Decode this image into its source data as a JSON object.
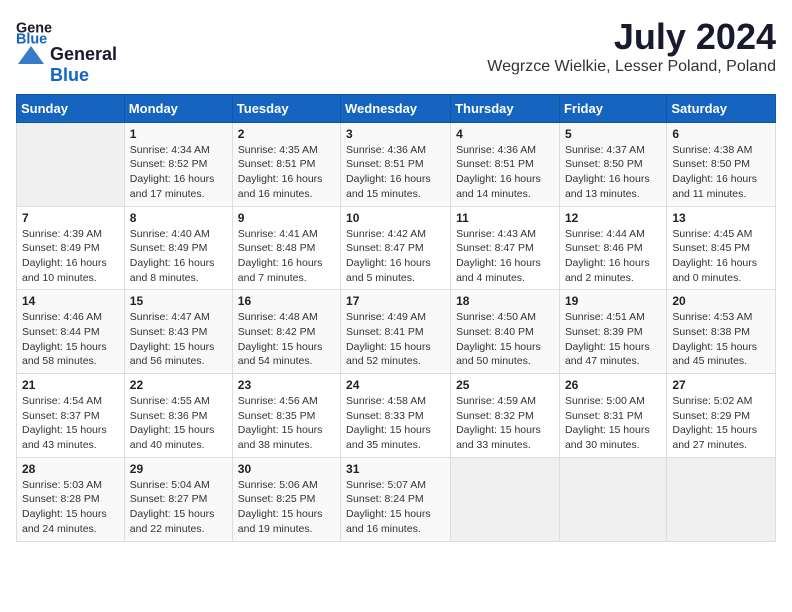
{
  "header": {
    "logo_general": "General",
    "logo_blue": "Blue",
    "month": "July 2024",
    "location": "Wegrzce Wielkie, Lesser Poland, Poland"
  },
  "days_of_week": [
    "Sunday",
    "Monday",
    "Tuesday",
    "Wednesday",
    "Thursday",
    "Friday",
    "Saturday"
  ],
  "weeks": [
    [
      {
        "num": "",
        "info": ""
      },
      {
        "num": "1",
        "info": "Sunrise: 4:34 AM\nSunset: 8:52 PM\nDaylight: 16 hours\nand 17 minutes."
      },
      {
        "num": "2",
        "info": "Sunrise: 4:35 AM\nSunset: 8:51 PM\nDaylight: 16 hours\nand 16 minutes."
      },
      {
        "num": "3",
        "info": "Sunrise: 4:36 AM\nSunset: 8:51 PM\nDaylight: 16 hours\nand 15 minutes."
      },
      {
        "num": "4",
        "info": "Sunrise: 4:36 AM\nSunset: 8:51 PM\nDaylight: 16 hours\nand 14 minutes."
      },
      {
        "num": "5",
        "info": "Sunrise: 4:37 AM\nSunset: 8:50 PM\nDaylight: 16 hours\nand 13 minutes."
      },
      {
        "num": "6",
        "info": "Sunrise: 4:38 AM\nSunset: 8:50 PM\nDaylight: 16 hours\nand 11 minutes."
      }
    ],
    [
      {
        "num": "7",
        "info": "Sunrise: 4:39 AM\nSunset: 8:49 PM\nDaylight: 16 hours\nand 10 minutes."
      },
      {
        "num": "8",
        "info": "Sunrise: 4:40 AM\nSunset: 8:49 PM\nDaylight: 16 hours\nand 8 minutes."
      },
      {
        "num": "9",
        "info": "Sunrise: 4:41 AM\nSunset: 8:48 PM\nDaylight: 16 hours\nand 7 minutes."
      },
      {
        "num": "10",
        "info": "Sunrise: 4:42 AM\nSunset: 8:47 PM\nDaylight: 16 hours\nand 5 minutes."
      },
      {
        "num": "11",
        "info": "Sunrise: 4:43 AM\nSunset: 8:47 PM\nDaylight: 16 hours\nand 4 minutes."
      },
      {
        "num": "12",
        "info": "Sunrise: 4:44 AM\nSunset: 8:46 PM\nDaylight: 16 hours\nand 2 minutes."
      },
      {
        "num": "13",
        "info": "Sunrise: 4:45 AM\nSunset: 8:45 PM\nDaylight: 16 hours\nand 0 minutes."
      }
    ],
    [
      {
        "num": "14",
        "info": "Sunrise: 4:46 AM\nSunset: 8:44 PM\nDaylight: 15 hours\nand 58 minutes."
      },
      {
        "num": "15",
        "info": "Sunrise: 4:47 AM\nSunset: 8:43 PM\nDaylight: 15 hours\nand 56 minutes."
      },
      {
        "num": "16",
        "info": "Sunrise: 4:48 AM\nSunset: 8:42 PM\nDaylight: 15 hours\nand 54 minutes."
      },
      {
        "num": "17",
        "info": "Sunrise: 4:49 AM\nSunset: 8:41 PM\nDaylight: 15 hours\nand 52 minutes."
      },
      {
        "num": "18",
        "info": "Sunrise: 4:50 AM\nSunset: 8:40 PM\nDaylight: 15 hours\nand 50 minutes."
      },
      {
        "num": "19",
        "info": "Sunrise: 4:51 AM\nSunset: 8:39 PM\nDaylight: 15 hours\nand 47 minutes."
      },
      {
        "num": "20",
        "info": "Sunrise: 4:53 AM\nSunset: 8:38 PM\nDaylight: 15 hours\nand 45 minutes."
      }
    ],
    [
      {
        "num": "21",
        "info": "Sunrise: 4:54 AM\nSunset: 8:37 PM\nDaylight: 15 hours\nand 43 minutes."
      },
      {
        "num": "22",
        "info": "Sunrise: 4:55 AM\nSunset: 8:36 PM\nDaylight: 15 hours\nand 40 minutes."
      },
      {
        "num": "23",
        "info": "Sunrise: 4:56 AM\nSunset: 8:35 PM\nDaylight: 15 hours\nand 38 minutes."
      },
      {
        "num": "24",
        "info": "Sunrise: 4:58 AM\nSunset: 8:33 PM\nDaylight: 15 hours\nand 35 minutes."
      },
      {
        "num": "25",
        "info": "Sunrise: 4:59 AM\nSunset: 8:32 PM\nDaylight: 15 hours\nand 33 minutes."
      },
      {
        "num": "26",
        "info": "Sunrise: 5:00 AM\nSunset: 8:31 PM\nDaylight: 15 hours\nand 30 minutes."
      },
      {
        "num": "27",
        "info": "Sunrise: 5:02 AM\nSunset: 8:29 PM\nDaylight: 15 hours\nand 27 minutes."
      }
    ],
    [
      {
        "num": "28",
        "info": "Sunrise: 5:03 AM\nSunset: 8:28 PM\nDaylight: 15 hours\nand 24 minutes."
      },
      {
        "num": "29",
        "info": "Sunrise: 5:04 AM\nSunset: 8:27 PM\nDaylight: 15 hours\nand 22 minutes."
      },
      {
        "num": "30",
        "info": "Sunrise: 5:06 AM\nSunset: 8:25 PM\nDaylight: 15 hours\nand 19 minutes."
      },
      {
        "num": "31",
        "info": "Sunrise: 5:07 AM\nSunset: 8:24 PM\nDaylight: 15 hours\nand 16 minutes."
      },
      {
        "num": "",
        "info": ""
      },
      {
        "num": "",
        "info": ""
      },
      {
        "num": "",
        "info": ""
      }
    ]
  ]
}
